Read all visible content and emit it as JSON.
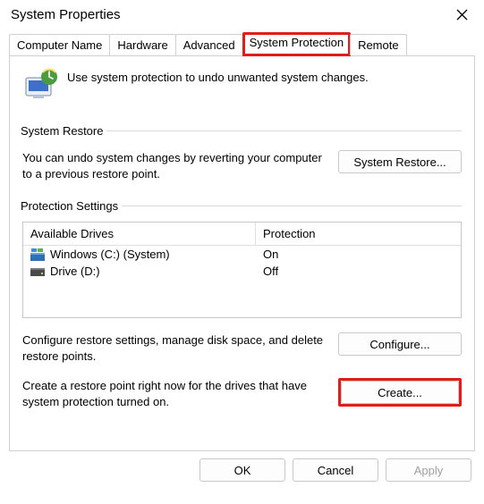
{
  "window": {
    "title": "System Properties"
  },
  "tabs": {
    "computer_name": "Computer Name",
    "hardware": "Hardware",
    "advanced": "Advanced",
    "system_protection": "System Protection",
    "remote": "Remote"
  },
  "intro": "Use system protection to undo unwanted system changes.",
  "restore": {
    "legend": "System Restore",
    "text": "You can undo system changes by reverting your computer to a previous restore point.",
    "button": "System Restore..."
  },
  "protection": {
    "legend": "Protection Settings",
    "col_drives": "Available Drives",
    "col_protection": "Protection",
    "rows": [
      {
        "name": "Windows (C:) (System)",
        "status": "On"
      },
      {
        "name": "Drive (D:)",
        "status": "Off"
      }
    ],
    "configure_text": "Configure restore settings, manage disk space, and delete restore points.",
    "configure_button": "Configure...",
    "create_text": "Create a restore point right now for the drives that have system protection turned on.",
    "create_button": "Create..."
  },
  "footer": {
    "ok": "OK",
    "cancel": "Cancel",
    "apply": "Apply"
  }
}
